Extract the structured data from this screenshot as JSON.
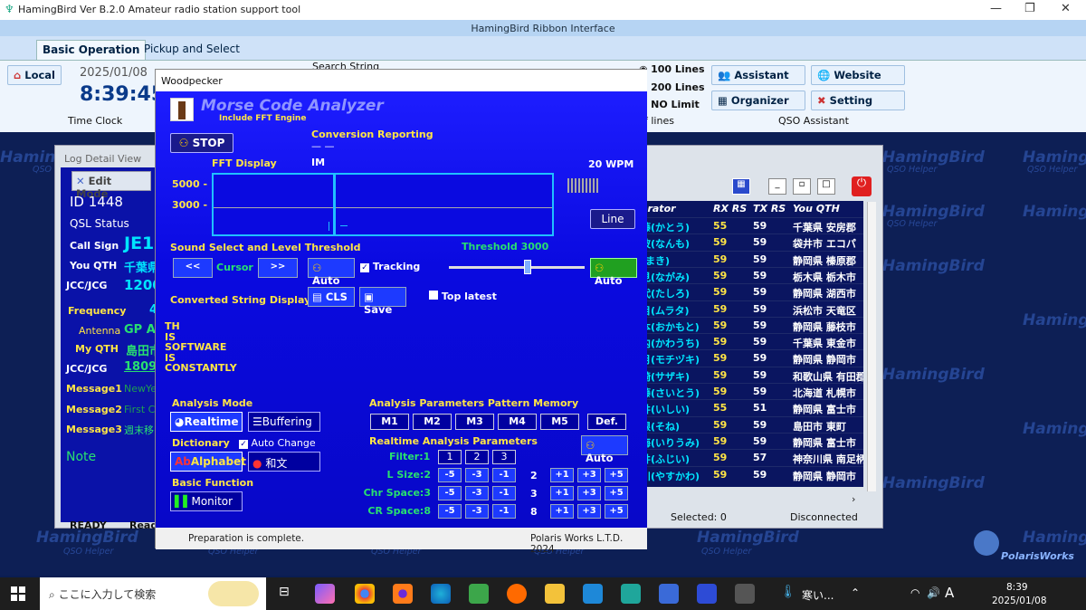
{
  "app_title": "HamingBird Ver B.2.0   Amateur radio station support tool",
  "ribbon": {
    "title": "HamingBird Ribbon Interface",
    "tabs": [
      "Basic Operation",
      "Pickup and Select"
    ],
    "local_label": "Local",
    "date": "2025/01/08",
    "time": "8:39:45",
    "time_clock_label": "Time Clock",
    "search_label": "Search String",
    "lines": [
      "100 Lines",
      "200 Lines",
      "NO Limit"
    ],
    "lines_group": "f lines",
    "assistant": "Assistant",
    "website": "Website",
    "organizer": "Organizer",
    "setting": "Setting",
    "qso_assistant": "QSO Assistant"
  },
  "watermark": {
    "name": "HamingBird",
    "sub": "QSO Helper"
  },
  "log": {
    "title": "Log Detail View",
    "edit_mode": "Edit Mode",
    "id": "ID 1448",
    "qsl_status": "QSL Status",
    "call_sign_label": "Call Sign",
    "call_sign": "JE1",
    "you_qth_label": "You QTH",
    "you_qth": "千葉県",
    "jcc_label": "JCC/JCG",
    "jcc": "1200",
    "frequency_label": "Frequency",
    "frequency": "4",
    "antenna_label": "Antenna",
    "antenna": "GP A",
    "my_qth_label": "My QTH",
    "my_qth": "島田市",
    "jcc2_label": "JCC/JCG",
    "jcc2": "1809",
    "msg1_label": "Message1",
    "msg1": "NewYe",
    "msg2_label": "Message2",
    "msg2": "First C",
    "msg3_label": "Message3",
    "msg3": "週末移",
    "note": "Note",
    "ready": "READY",
    "read": "Read",
    "selected": "Selected: 0",
    "connection": "Disconnected"
  },
  "table": {
    "headers": [
      "erator",
      "RX RS",
      "TX RS",
      "You QTH"
    ],
    "rows": [
      [
        "藤(かとう)",
        "55",
        "59",
        "千葉県 安房郡"
      ],
      [
        "波(なんも)",
        "59",
        "59",
        "袋井市 エコパ"
      ],
      [
        "(まき)",
        "59",
        "59",
        "静岡県 榛原郡"
      ],
      [
        "見(ながみ)",
        "59",
        "59",
        "栃木県 栃木市"
      ],
      [
        "代(たしろ)",
        "59",
        "59",
        "静岡県 湖西市"
      ],
      [
        "目(ムラタ)",
        "59",
        "59",
        "浜松市 天竜区"
      ],
      [
        "本(おかもと)",
        "59",
        "59",
        "静岡県 藤枝市"
      ],
      [
        "内(かわうち)",
        "59",
        "59",
        "千葉県 東金市"
      ],
      [
        "月(モチヅキ)",
        "59",
        "59",
        "静岡県 静岡市"
      ],
      [
        "崎(サザキ)",
        "59",
        "59",
        "和歌山県 有田郡"
      ],
      [
        "藤(さいとう)",
        "59",
        "59",
        "北海道 札幌市"
      ],
      [
        "井(いしい)",
        "55",
        "51",
        "静岡県 富士市"
      ],
      [
        "根(そね)",
        "59",
        "59",
        "島田市 東町"
      ],
      [
        "海(いりうみ)",
        "59",
        "59",
        "静岡県 富士市"
      ],
      [
        "井(ふじい)",
        "59",
        "57",
        "神奈川県 南足柄"
      ],
      [
        "川(やすかわ)",
        "59",
        "59",
        "静岡県 静岡市"
      ]
    ]
  },
  "woodpecker": {
    "window_title": "Woodpecker",
    "app_name": "Morse Code Analyzer",
    "subtitle": "Include FFT Engine",
    "stop": "STOP",
    "conversion_reporting": "Conversion Reporting",
    "conversion_value": "— —",
    "fft_display": "FFT Display",
    "fft_char": "IM",
    "wpm": "20 WPM",
    "freq_high": "5000 -",
    "freq_low": "3000 -",
    "line_btn": "Line",
    "sound_select": "Sound Select and Level Threshold",
    "threshold": "Threshold  3000",
    "threshold_value": 0.58,
    "left_btn": "<<",
    "cursor": "Cursor",
    "right_btn": ">>",
    "auto1": "Auto",
    "tracking": "Tracking",
    "auto2": "Auto",
    "converted": "Converted String Display",
    "cls": "CLS",
    "save": "Save",
    "top_latest": "Top latest",
    "decoded": [
      "TH",
      "IS",
      "SOFTWARE",
      "IS",
      "CONSTANTLY"
    ],
    "analysis_mode": "Analysis Mode",
    "realtime": "Realtime",
    "buffering": "Buffering",
    "dictionary": "Dictionary",
    "auto_change": "Auto Change",
    "alphabet": "Alphabet",
    "wabun": "和文",
    "basic_function": "Basic Function",
    "monitor": "Monitor",
    "pattern_memory": "Analysis Parameters Pattern Memory",
    "memories": [
      "M1",
      "M2",
      "M3",
      "M4",
      "M5",
      "Def."
    ],
    "realtime_params": "Realtime Analysis Parameters",
    "auto3": "Auto",
    "filter_label": "Filter:1",
    "filters": [
      "1",
      "2",
      "3"
    ],
    "lsize_label": "L Size:2",
    "lsize_val": "2",
    "chr_label": "Chr Space:3",
    "chr_val": "3",
    "cr_label": "CR Space:8",
    "cr_val": "8",
    "minus": [
      "-5",
      "-3",
      "-1"
    ],
    "plus": [
      "+1",
      "+3",
      "+5"
    ],
    "status": "Preparation is complete.",
    "company": "Polaris Works L.T.D.  2024"
  },
  "polaris": "PolarisWorks",
  "taskbar": {
    "search": "ここに入力して検索",
    "weather": "寒い...",
    "ime": "A",
    "time": "8:39",
    "date": "2025/01/08"
  }
}
